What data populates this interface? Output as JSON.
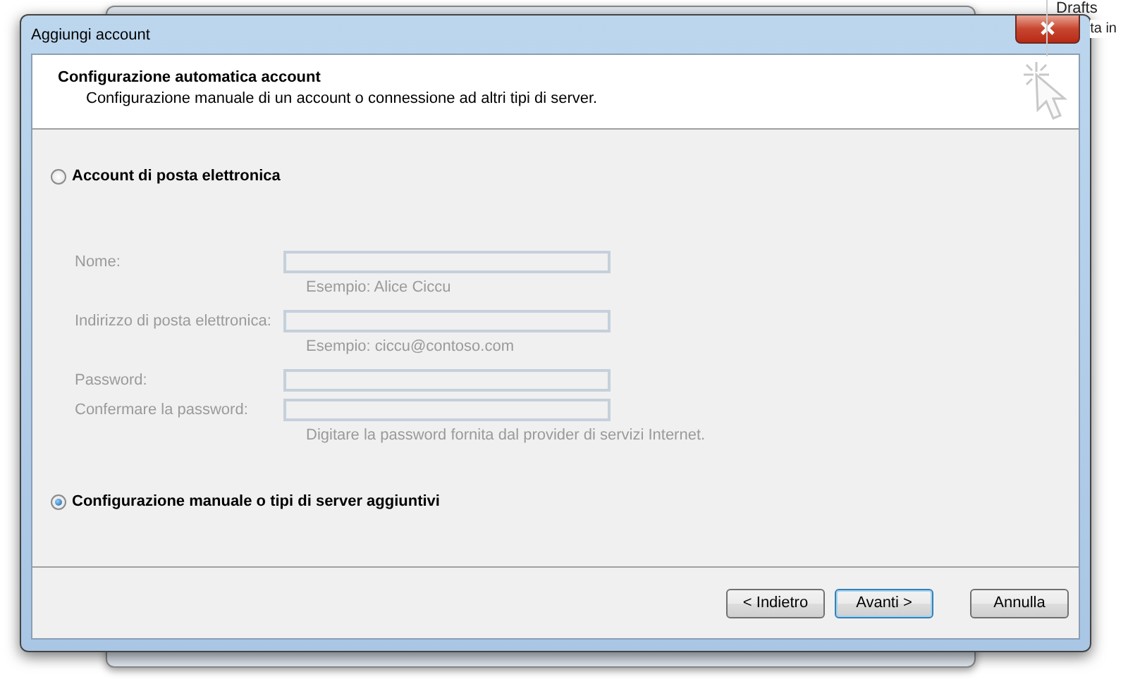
{
  "background": {
    "folders": [
      "Drafts",
      "ta in"
    ]
  },
  "window": {
    "title": "Aggiungi account"
  },
  "header": {
    "title": "Configurazione automatica account",
    "subtitle": "Configurazione manuale di un account o connessione ad altri tipi di server."
  },
  "options": [
    {
      "label": "Account di posta elettronica",
      "selected": false
    },
    {
      "label": "Configurazione manuale o tipi di server aggiuntivi",
      "selected": true
    }
  ],
  "fields": [
    {
      "label": "Nome:",
      "hint": "Esempio: Alice Ciccu",
      "disabled": true
    },
    {
      "label": "Indirizzo di posta elettronica:",
      "hint": "Esempio: ciccu@contoso.com",
      "disabled": true
    },
    {
      "label": "Password:",
      "disabled": true
    },
    {
      "label": "Confermare la password:",
      "hint": "Digitare la password fornita dal provider di servizi Internet.",
      "disabled": true
    }
  ],
  "buttons": [
    {
      "label": "< Indietro",
      "default": false
    },
    {
      "label": "Avanti >",
      "default": true
    },
    {
      "label": "Annulla",
      "default": false
    }
  ]
}
